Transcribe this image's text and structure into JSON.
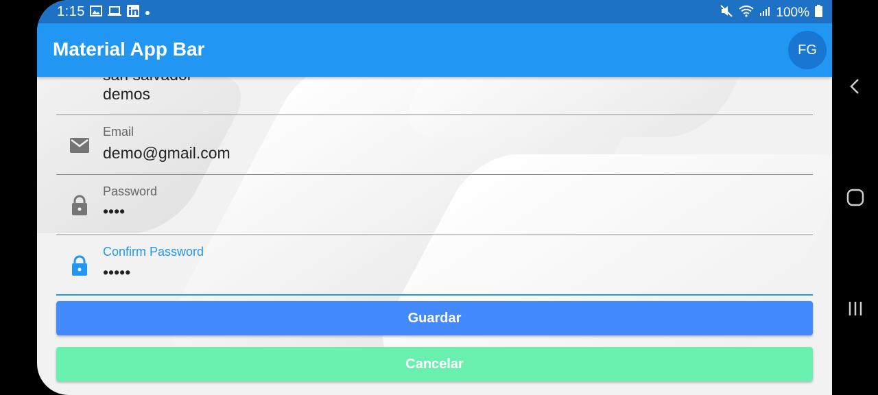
{
  "status_bar": {
    "time": "1:15",
    "battery": "100%"
  },
  "app_bar": {
    "title": "Material App Bar",
    "avatar_initials": "FG"
  },
  "form": {
    "partial_line": "san salvador",
    "partial_value": "demos",
    "email": {
      "label": "Email",
      "value": "demo@gmail.com",
      "icon": "mail-icon"
    },
    "password": {
      "label": "Password",
      "value": "••••",
      "icon": "lock-icon"
    },
    "confirm_password": {
      "label": "Confirm Password",
      "value": "•••••",
      "icon": "lock-icon"
    }
  },
  "buttons": {
    "save": "Guardar",
    "cancel": "Cancelar"
  },
  "colors": {
    "status_bar": "#1d72c5",
    "app_bar": "#2196f3",
    "save_button": "#448aff",
    "cancel_button": "#69f0ae",
    "focus": "#2196f3"
  }
}
